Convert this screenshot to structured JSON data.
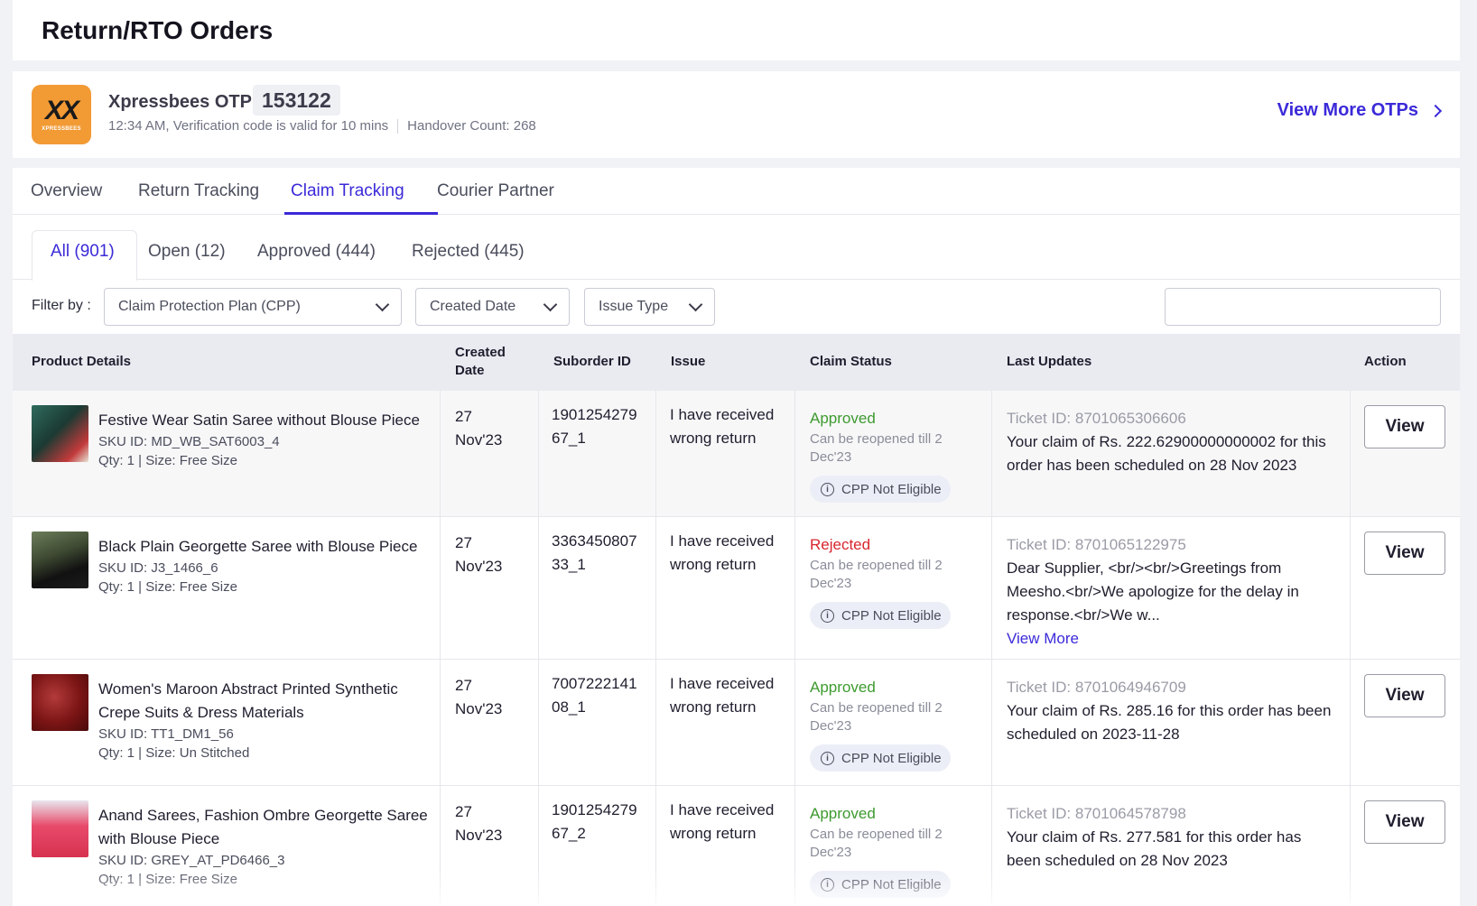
{
  "header": {
    "title": "Return/RTO Orders"
  },
  "otp": {
    "courier_label": "Xpressbees OTP:",
    "code": "153122",
    "logo_text": "XPRESSBEES",
    "timestamp_text": "12:34 AM, Verification code is valid for 10 mins",
    "handover_text": "Handover Count: 268",
    "view_more_label": "View More OTPs",
    "logo_color": "#f29a34"
  },
  "tabs": [
    {
      "label": "Overview"
    },
    {
      "label": "Return Tracking"
    },
    {
      "label": "Claim Tracking",
      "active": true
    },
    {
      "label": "Courier Partner"
    }
  ],
  "sub_tabs": [
    {
      "label": "All (901)",
      "active": true
    },
    {
      "label": "Open (12)"
    },
    {
      "label": "Approved (444)"
    },
    {
      "label": "Rejected (445)"
    }
  ],
  "filters": {
    "label": "Filter by :",
    "cpp": "Claim Protection Plan (CPP)",
    "created_date": "Created Date",
    "issue_type": "Issue Type",
    "search_value": ""
  },
  "table": {
    "headers": {
      "product": "Product Details",
      "created_line1": "Created",
      "created_line2": "Date",
      "suborder": "Suborder ID",
      "issue": "Issue",
      "status": "Claim Status",
      "updates": "Last Updates",
      "action": "Action"
    },
    "rows": [
      {
        "name": "Festive Wear Satin Saree without Blouse Piece",
        "sku": "SKU ID: MD_WB_SAT6003_4",
        "qty": "Qty: 1 | Size: Free Size",
        "date_line1": "27",
        "date_line2": "Nov'23",
        "suborder_line1": "1901254279",
        "suborder_line2": "67_1",
        "issue_line1": "I have received",
        "issue_line2": "wrong return",
        "status": "Approved",
        "status_sub_line1": "Can be reopened till 2",
        "status_sub_line2": "Dec'23",
        "badge": "CPP Not Eligible",
        "ticket": "Ticket ID: 8701065306606",
        "message": "Your claim of Rs. 222.62900000000002 for this order has been scheduled on 28 Nov 2023",
        "view_more": "",
        "action": "View"
      },
      {
        "name": "Black Plain Georgette Saree with Blouse Piece",
        "sku": "SKU ID: J3_1466_6",
        "qty": "Qty: 1 | Size: Free Size",
        "date_line1": "27",
        "date_line2": "Nov'23",
        "suborder_line1": "3363450807",
        "suborder_line2": "33_1",
        "issue_line1": "I have received",
        "issue_line2": "wrong return",
        "status": "Rejected",
        "status_sub_line1": "Can be reopened till 2",
        "status_sub_line2": "Dec'23",
        "badge": "CPP Not Eligible",
        "ticket": "Ticket ID: 8701065122975",
        "message": "Dear Supplier, <br/><br/>Greetings from Meesho.<br/>We apologize for the delay in response.<br/>We w...",
        "view_more": "View More",
        "action": "View"
      },
      {
        "name": "Women's Maroon Abstract Printed Synthetic Crepe Suits & Dress Materials",
        "sku": "SKU ID: TT1_DM1_56",
        "qty": "Qty: 1 | Size: Un Stitched",
        "date_line1": "27",
        "date_line2": "Nov'23",
        "suborder_line1": "7007222141",
        "suborder_line2": "08_1",
        "issue_line1": "I have received",
        "issue_line2": "wrong return",
        "status": "Approved",
        "status_sub_line1": "Can be reopened till 2",
        "status_sub_line2": "Dec'23",
        "badge": "CPP Not Eligible",
        "ticket": "Ticket ID: 8701064946709",
        "message": "Your claim of Rs. 285.16 for this order has been scheduled on 2023-11-28",
        "view_more": "",
        "action": "View"
      },
      {
        "name": "Anand Sarees, Fashion Ombre Georgette Saree with Blouse Piece",
        "sku": "SKU ID: GREY_AT_PD6466_3",
        "qty": "Qty: 1 | Size: Free Size",
        "date_line1": "27",
        "date_line2": "Nov'23",
        "suborder_line1": "1901254279",
        "suborder_line2": "67_2",
        "issue_line1": "I have received",
        "issue_line2": "wrong return",
        "status": "Approved",
        "status_sub_line1": "Can be reopened till 2",
        "status_sub_line2": "Dec'23",
        "badge": "CPP Not Eligible",
        "ticket": "Ticket ID: 8701064578798",
        "message": "Your claim of Rs. 277.581 for this order has been scheduled on 28 Nov 2023",
        "view_more": "",
        "action": "View"
      }
    ]
  },
  "colors": {
    "accent": "#3b2ad8",
    "approved": "#3d9a2f",
    "rejected": "#d8262e"
  }
}
